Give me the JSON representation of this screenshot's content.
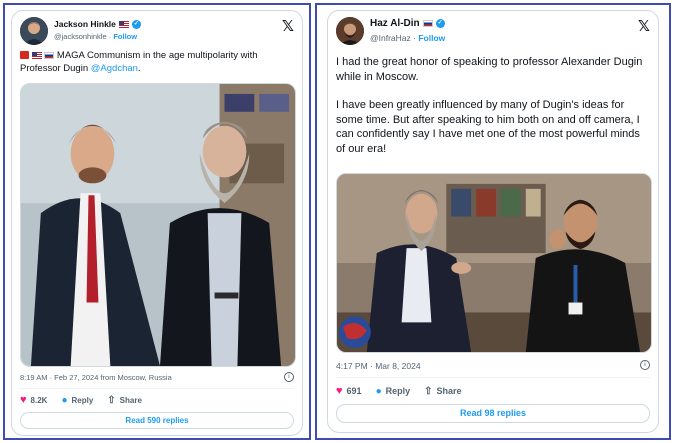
{
  "left_tweet": {
    "author_name": "Jackson Hinkle",
    "author_handle": "@jacksonhinkle",
    "follow_label": "Follow",
    "text_main": "MAGA Communism in the age multipolarity with Professor Dugin",
    "mention": "@Agdchan",
    "text_end": ".",
    "timestamp": "8:19 AM · Feb 27, 2024 from Moscow, Russia",
    "likes": "8.2K",
    "reply_label": "Reply",
    "share_label": "Share",
    "read_replies": "Read 590 replies",
    "info_glyph": "i"
  },
  "right_tweet": {
    "author_name": "Haz Al-Din",
    "author_handle": "@InfraHaz",
    "follow_label": "Follow",
    "paragraph1": "I had the great honor of speaking to professor Alexander Dugin while in Moscow.",
    "paragraph2": "I have been greatly influenced by many of Dugin's ideas for some time. But after speaking to him both on and off camera, I can confidently say I have met one of the most powerful minds of our era!",
    "timestamp": "4:17 PM · Mar 8, 2024",
    "likes": "691",
    "reply_label": "Reply",
    "share_label": "Share",
    "read_replies": "Read 98 replies",
    "info_glyph": "i"
  },
  "common": {
    "separator": "·",
    "x_logo": "𝕏",
    "verified_glyph": "✓"
  },
  "colors": {
    "frame_border": "#3f4bb0",
    "link_blue": "#1d9bf0",
    "like_pink": "#f91880",
    "muted_text": "#536471",
    "card_border": "#cfd9de"
  },
  "icons": [
    "verified-badge-icon",
    "us-flag-icon",
    "russia-flag-icon",
    "x-logo-icon",
    "info-icon",
    "heart-icon",
    "reply-icon",
    "share-icon"
  ]
}
